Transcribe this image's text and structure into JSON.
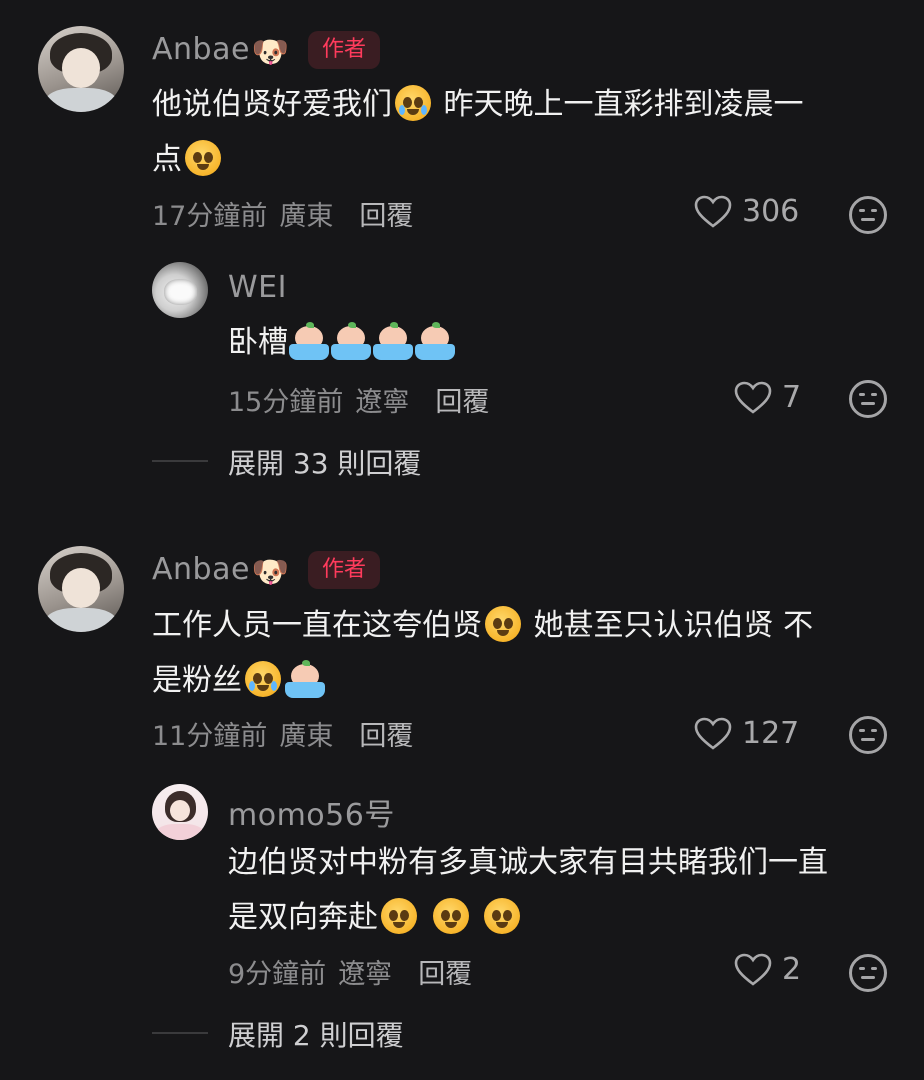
{
  "comments": [
    {
      "author": "Anbae",
      "author_emoji": "🐶",
      "badge": "作者",
      "line1a": "他说伯贤好爱我们",
      "line1b": "昨天晚上一直彩排到凌晨一",
      "line2": "点",
      "time": "17分鐘前",
      "location": "廣東",
      "reply_label": "回覆",
      "likes": "306"
    },
    {
      "author": "WEI",
      "text": "卧槽",
      "time": "15分鐘前",
      "location": "遼寧",
      "reply_label": "回覆",
      "likes": "7",
      "expand_label": "展開 33 則回覆"
    },
    {
      "author": "Anbae",
      "author_emoji": "🐶",
      "badge": "作者",
      "line1a": "工作人员一直在这夸伯贤",
      "line1b": "她甚至只认识伯贤 不",
      "line2": "是粉丝",
      "time": "11分鐘前",
      "location": "廣東",
      "reply_label": "回覆",
      "likes": "127"
    },
    {
      "author": "momo56号",
      "line1": "边伯贤对中粉有多真诚大家有目共睹我们一直",
      "line2": "是双向奔赴",
      "time": "9分鐘前",
      "location": "遼寧",
      "reply_label": "回覆",
      "likes": "2",
      "expand_label": "展開 2 則回覆"
    }
  ],
  "icons": {
    "like": "heart-outline-icon",
    "emoji_reaction": "neutral-face-icon"
  },
  "colors": {
    "background": "#161618",
    "badge_text": "#ff3b5c",
    "muted_text": "#8c8c8e"
  }
}
